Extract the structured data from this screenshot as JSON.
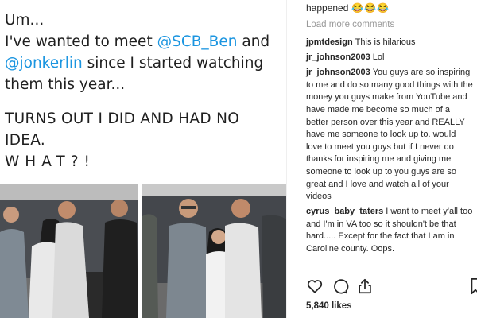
{
  "tweet": {
    "line1": "Um...",
    "line2_pre": "I've wanted to meet ",
    "mention1": "@SCB_Ben",
    "line2_post": " and",
    "mention2": "@jonkerlin",
    "line3_post": " since I started watching",
    "line4": "them this year...",
    "line5": "TURNS OUT I DID AND HAD NO IDEA.",
    "line6": "WHAT?!",
    "mention_color": "#1b95e0"
  },
  "caption": {
    "tail": "happened",
    "emojis": "😂😂😂"
  },
  "load_more": "Load more comments",
  "comments": [
    {
      "user": "jpmtdesign",
      "text": "This is hilarious"
    },
    {
      "user": "jr_johnson2003",
      "text": "Lol"
    },
    {
      "user": "jr_johnson2003",
      "text": "You guys are so inspiring to me and do so many good things with the money you guys make from YouTube and have made me become so much of a better person over this year and REALLY have me someone to look up to. would love to meet you guys but if I never do thanks for inspiring me and giving me someone to look up to you guys are so great and I love and watch all of your videos"
    },
    {
      "user": "cyrus_baby_taters",
      "text": "I want to meet y'all too and I'm in VA too so it shouldn't be that hard..... Except for the fact that I am in Caroline county. Oops."
    }
  ],
  "actions": {
    "icons": [
      "heart-icon",
      "comment-bubble-icon",
      "share-icon",
      "bookmark-icon"
    ]
  },
  "likes": "5,840 likes",
  "colors": {
    "text": "#262626",
    "muted": "#999999",
    "divider": "#efefef"
  }
}
